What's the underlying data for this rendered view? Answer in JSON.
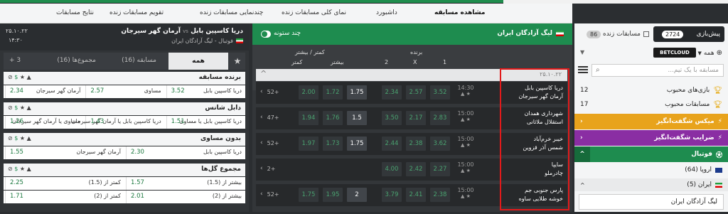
{
  "nav": {
    "tabs": [
      "مشاهده مسابقه",
      "داشبورد",
      "نمای کلی مسابقات زنده",
      "چندنمایی مسابقات زنده",
      "تقویم مسابقات زنده",
      "نتایج مسابقات"
    ]
  },
  "sidebar": {
    "live_tab": "مسابقات زنده",
    "live_count": "86",
    "prematch_tab": "پیش‌بازی",
    "prematch_count": "2724",
    "all_label": "همه",
    "provider": "BETCLOUD",
    "search_placeholder": "مسابقه با یک تیم...",
    "favorites": [
      {
        "label": "بازی‌های محبوب",
        "count": "12"
      },
      {
        "label": "مسابقات محبوب",
        "count": "17"
      }
    ],
    "mix_label": "میکس شگفت‌انگیز",
    "multi_label": "ضرایب شگفت‌انگیز",
    "football_label": "فوتبال",
    "europe_label": "اروپا (64)",
    "iran_label": "ایران (5)",
    "league_label": "لیگ آزادگان ایران"
  },
  "middle": {
    "league_title": "لیگ آزادگان ایران",
    "multi_col_label": "چند ستونه",
    "col_group_winner": "برنده",
    "col_group_ou": "کمتر / بیشتر",
    "cols": [
      "1",
      "X",
      "2",
      "بیشتر",
      "کمتر"
    ],
    "date": "۲۵.۱۰.۲۲",
    "matches": [
      {
        "home": "دریا کاسپین بابل",
        "away": "آرمان گهر سیرجان",
        "time": "14:30",
        "o1": "3.52",
        "ox": "2.57",
        "o2": "2.34",
        "line": "1.75",
        "over": "1.72",
        "under": "2.00",
        "more": "52+"
      },
      {
        "home": "شهرداری همدان",
        "away": "استقلال ملاثانی",
        "time": "15:00",
        "o1": "2.83",
        "ox": "2.17",
        "o2": "3.50",
        "line": "1.5",
        "over": "1.76",
        "under": "1.94",
        "more": "47+"
      },
      {
        "home": "خیبر خرم‌آباد",
        "away": "شمس آذر قزوین",
        "time": "15:00",
        "o1": "3.62",
        "ox": "2.38",
        "o2": "2.44",
        "line": "1.75",
        "over": "1.73",
        "under": "1.97",
        "more": "52+"
      },
      {
        "home": "سایپا",
        "away": "چادرملو",
        "time": "15:00",
        "o1": "2.27",
        "ox": "2.42",
        "o2": "4.00",
        "line": "",
        "over": "",
        "under": "",
        "more": "2+"
      },
      {
        "home": "پارس جنوبی جم",
        "away": "خوشه طلایی ساوه",
        "time": "15:00",
        "o1": "2.38",
        "ox": "2.41",
        "o2": "3.79",
        "line": "2",
        "over": "1.95",
        "under": "1.75",
        "more": "52+"
      }
    ]
  },
  "left": {
    "match_title": "دریا کاسپین بابل",
    "vs": "vs",
    "match_away": "آرمان گهر سیرجان",
    "league": "فوتبال - لیگ آزادگان ایران",
    "date": "۲۵.۱۰.۲۲",
    "time": "۱۴:۳۰",
    "tab_all": "همه",
    "tab_match": "مسابقه (16)",
    "tab_total": "مجموع‌ها (16)",
    "tab_more": "+ 3",
    "markets": [
      {
        "title": "برنده مسابقه",
        "rows": [
          [
            {
              "l": "دریا کاسپین بابل",
              "v": "3.52"
            },
            {
              "l": "مساوی",
              "v": "2.57"
            },
            {
              "l": "آرمان گهر سیرجان",
              "v": "2.34"
            }
          ]
        ]
      },
      {
        "title": "دابل شانس",
        "rows": [
          [
            {
              "l": "دریا کاسپین بابل یا مساوی",
              "v": "1.51"
            },
            {
              "l": "دریا کاسپین بابل یا آرمان گهر سیرجان",
              "v": "1.43"
            },
            {
              "l": "مساوی یا آرمان گهر سیرجان",
              "v": "1.26"
            }
          ]
        ]
      },
      {
        "title": "بدون مساوی",
        "rows": [
          [
            {
              "l": "دریا کاسپین بابل",
              "v": "2.30"
            },
            {
              "l": "آرمان گهر سیرجان",
              "v": "1.55"
            }
          ]
        ]
      },
      {
        "title": "مجموع گل‌ها",
        "rows": [
          [
            {
              "l": "بیشتر از (1.5)",
              "v": "1.57"
            },
            {
              "l": "کمتر از (1.5)",
              "v": "2.25"
            }
          ],
          [
            {
              "l": "بیشتر از (2)",
              "v": "2.01"
            },
            {
              "l": "کمتر از (2)",
              "v": "1.71"
            }
          ]
        ]
      }
    ]
  }
}
